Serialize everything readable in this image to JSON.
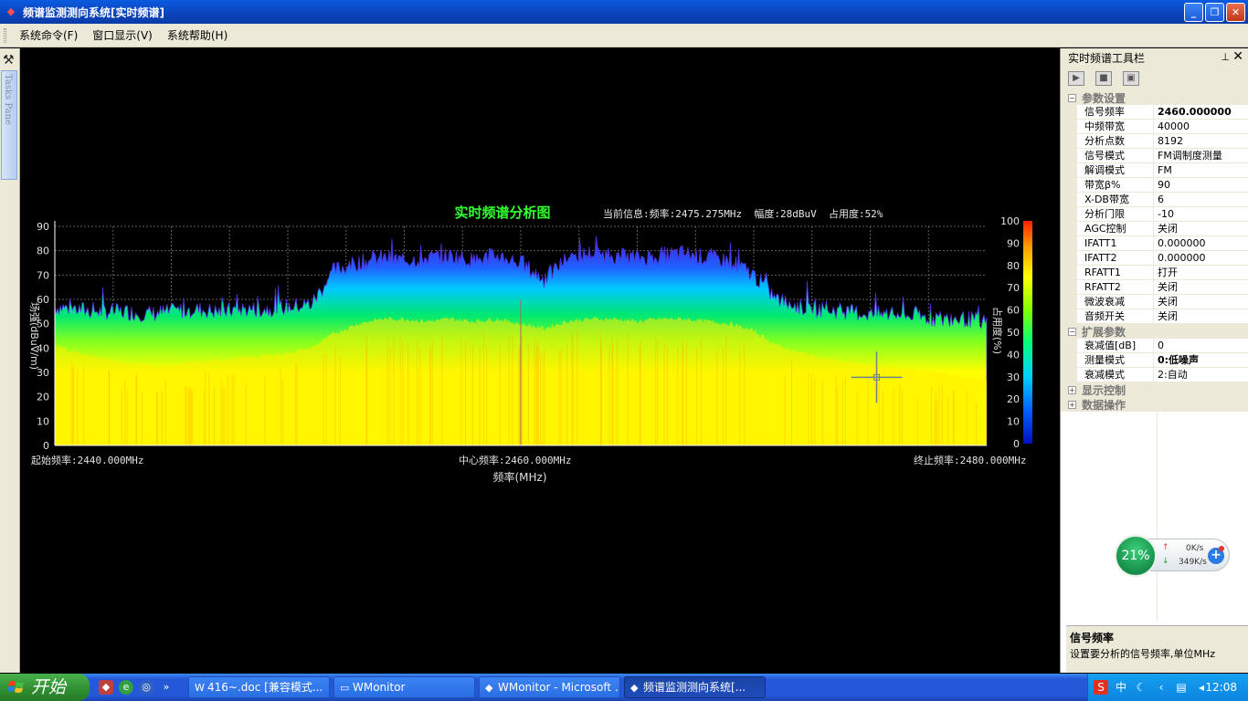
{
  "window": {
    "title": "频谱监测测向系统[实时频谱]",
    "minimize": "_",
    "maximize": "❐",
    "close": "✕"
  },
  "menu": {
    "items": [
      "系统命令(F)",
      "窗口显示(V)",
      "系统帮助(H)"
    ]
  },
  "tasks_pane_label": "Tasks Pane",
  "chart_data": {
    "type": "area",
    "title": "实时频谱分析图",
    "info": "当前信息:频率:2475.275MHz  幅度:28dBuV  占用度:52%",
    "xlabel": "频率(MHz)",
    "ylabel": "场强(dBuV/m)",
    "ylabel_right": "占用度(%)",
    "ylim": [
      0,
      90
    ],
    "yticks": [
      0,
      10,
      20,
      30,
      40,
      50,
      60,
      70,
      80,
      90
    ],
    "right_ticks": [
      0,
      10,
      20,
      30,
      40,
      50,
      60,
      70,
      80,
      90,
      100
    ],
    "xlim": [
      2440.0,
      2480.0
    ],
    "start_label": "起始频率:2440.000MHz",
    "center_label": "中心频率:2460.000MHz",
    "end_label": "终止频率:2480.000MHz",
    "grid": true,
    "color_scale": [
      "#0000c0",
      "#0040ff",
      "#00c0ff",
      "#00ff80",
      "#80ff00",
      "#ffff00",
      "#ffc000",
      "#ff4000",
      "#ff0000"
    ],
    "series": [
      {
        "x": [
          2440,
          2441,
          2442,
          2443,
          2444,
          2445,
          2446,
          2447,
          2448,
          2449,
          2450,
          2451,
          2452,
          2453,
          2454,
          2455,
          2456,
          2457,
          2458,
          2459,
          2460,
          2461,
          2462,
          2463,
          2464,
          2465,
          2466,
          2467,
          2468,
          2469,
          2470,
          2471,
          2472,
          2473,
          2474,
          2475,
          2476,
          2477,
          2478,
          2479,
          2480
        ],
        "peak": [
          57,
          56,
          55,
          55,
          54,
          55,
          56,
          55,
          56,
          56,
          57,
          58,
          72,
          75,
          77,
          76,
          77,
          78,
          76,
          78,
          75,
          68,
          77,
          79,
          78,
          77,
          78,
          79,
          77,
          76,
          70,
          60,
          57,
          56,
          55,
          54,
          54,
          53,
          52,
          52,
          51
        ],
        "floor": [
          41,
          38,
          36,
          34,
          33,
          33,
          34,
          35,
          36,
          37,
          38,
          40,
          46,
          50,
          52,
          52,
          51,
          52,
          51,
          52,
          50,
          48,
          51,
          52,
          52,
          51,
          52,
          52,
          51,
          50,
          47,
          41,
          38,
          36,
          34,
          33,
          32,
          31,
          30,
          28,
          27
        ]
      }
    ],
    "cursor": {
      "x": 2475.275,
      "y": 28
    }
  },
  "toolbar_panel": {
    "title": "实时频谱工具栏",
    "pin": "⊥",
    "close": "✕",
    "buttons": [
      "play-icon",
      "stop-icon",
      "window-icon"
    ]
  },
  "properties": {
    "cat1": "参数设置",
    "rows1": [
      {
        "k": "信号频率",
        "v": "2460.000000"
      },
      {
        "k": "中频带宽",
        "v": "40000"
      },
      {
        "k": "分析点数",
        "v": "8192"
      },
      {
        "k": "信号模式",
        "v": "FM调制度测量"
      },
      {
        "k": "解调模式",
        "v": "FM"
      },
      {
        "k": "带宽β%",
        "v": "90"
      },
      {
        "k": "X-DB带宽",
        "v": "6"
      },
      {
        "k": "分析门限",
        "v": "-10"
      },
      {
        "k": "AGC控制",
        "v": "关闭"
      },
      {
        "k": "IFATT1",
        "v": "0.000000"
      },
      {
        "k": "IFATT2",
        "v": "0.000000"
      },
      {
        "k": "RFATT1",
        "v": "打开"
      },
      {
        "k": "RFATT2",
        "v": "关闭"
      },
      {
        "k": "微波衰减",
        "v": "关闭"
      },
      {
        "k": "音频开关",
        "v": "关闭"
      }
    ],
    "cat2": "扩展参数",
    "rows2": [
      {
        "k": "衰减值[dB]",
        "v": "0"
      },
      {
        "k": "测量模式",
        "v": "0:低噪声"
      },
      {
        "k": "衰减模式",
        "v": "2:自动"
      }
    ],
    "cat3": "显示控制",
    "cat4": "数据操作",
    "help_title": "信号频率",
    "help_desc": "设置要分析的信号频率,单位MHz"
  },
  "net_widget": {
    "percent": "21%",
    "up": "0K/s",
    "down": "349K/s"
  },
  "taskbar": {
    "start": "开始",
    "tasks": [
      {
        "label": "416~.doc [兼容模式...",
        "icon": "W"
      },
      {
        "label": "WMonitor",
        "icon": "▭"
      },
      {
        "label": "WMonitor - Microsoft ...",
        "icon": "◆"
      },
      {
        "label": "频谱监测测向系统[...",
        "icon": "◆"
      }
    ],
    "tray_lang": "中",
    "clock": "12:08"
  }
}
